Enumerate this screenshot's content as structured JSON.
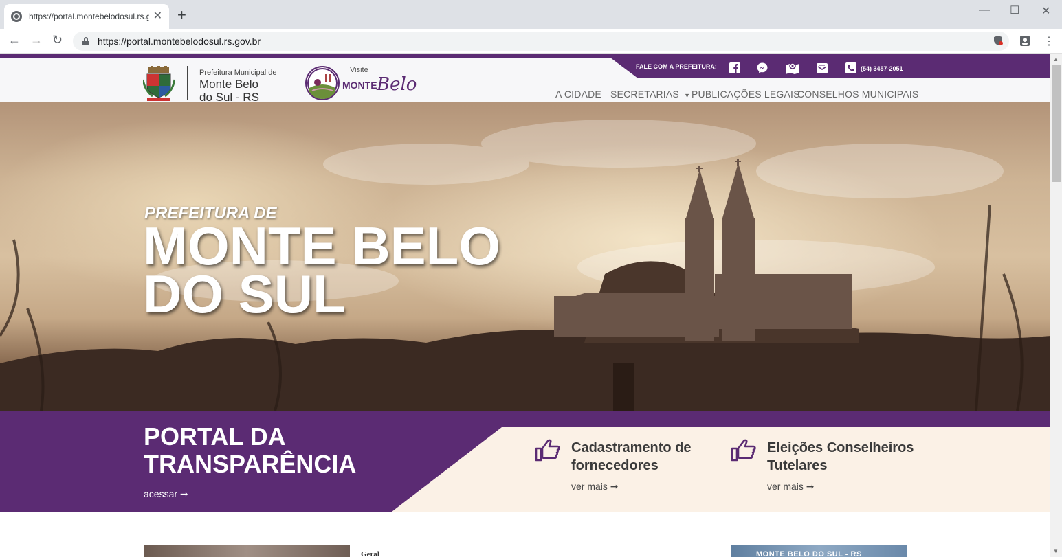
{
  "browser": {
    "tab_title": "https://portal.montebelodosul.rs.gov.br",
    "url": "https://portal.montebelodosul.rs.gov.br",
    "new_tab": "+",
    "close": "✕"
  },
  "header": {
    "muni_small": "Prefeitura Municipal de",
    "muni_line1": "Monte Belo",
    "muni_line2": "do Sul - RS",
    "visit_small": "Visite",
    "visit_monte": "MONTE",
    "visit_belo": "Belo"
  },
  "contact": {
    "label": "FALE COM A PREFEITURA:",
    "phone": "(54) 3457-2051"
  },
  "nav": {
    "items": [
      "A CIDADE",
      "SECRETARIAS",
      "PUBLICAÇÕES LEGAIS",
      "CONSELHOS MUNICIPAIS"
    ]
  },
  "hero": {
    "pre": "PREFEITURA DE",
    "title_line1": "MONTE BELO",
    "title_line2": "DO SUL"
  },
  "transparency": {
    "title_line1": "PORTAL DA",
    "title_line2": "TRANSPARÊNCIA",
    "link": "acessar ➞"
  },
  "cards": [
    {
      "title_line1": "Cadastramento de",
      "title_line2": "fornecedores",
      "link": "ver mais ➞"
    },
    {
      "title_line1": "Eleições Conselheiros",
      "title_line2": "Tutelares",
      "link": "ver mais ➞"
    }
  ],
  "below": {
    "category": "Geral",
    "right_banner": "MONTE BELO DO SUL - RS"
  },
  "colors": {
    "brand_purple": "#5b2b73",
    "cream": "#fbf1e6"
  }
}
